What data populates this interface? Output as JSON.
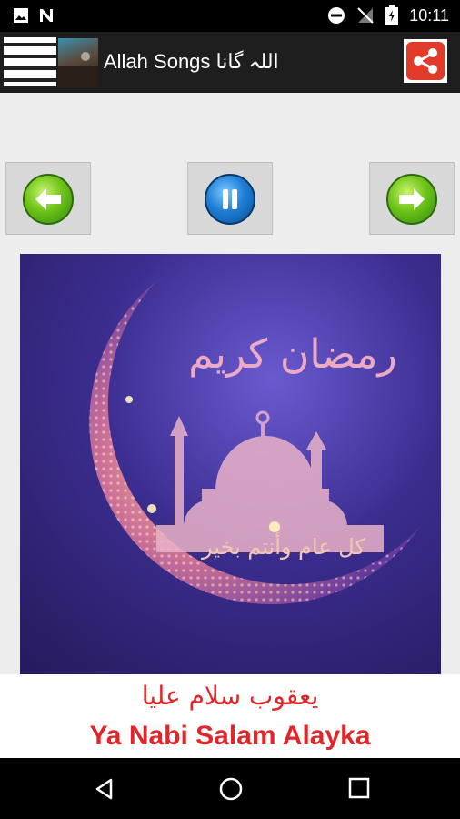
{
  "status_bar": {
    "time": "10:11"
  },
  "app_bar": {
    "title": "Allah Songs اللہ گانا"
  },
  "player": {
    "prev_icon": "arrow-left-icon",
    "pause_icon": "pause-icon",
    "next_icon": "arrow-right-icon"
  },
  "artwork": {
    "calligraphy_top": "رمضان كريم",
    "calligraphy_bottom": "كل عام وأنتم بخير"
  },
  "song": {
    "arabic_title": "يعقوب سلام عليا",
    "title": "Ya Nabi Salam Alayka"
  },
  "colors": {
    "accent_red": "#e0262a",
    "share_red": "#e23b2a"
  }
}
